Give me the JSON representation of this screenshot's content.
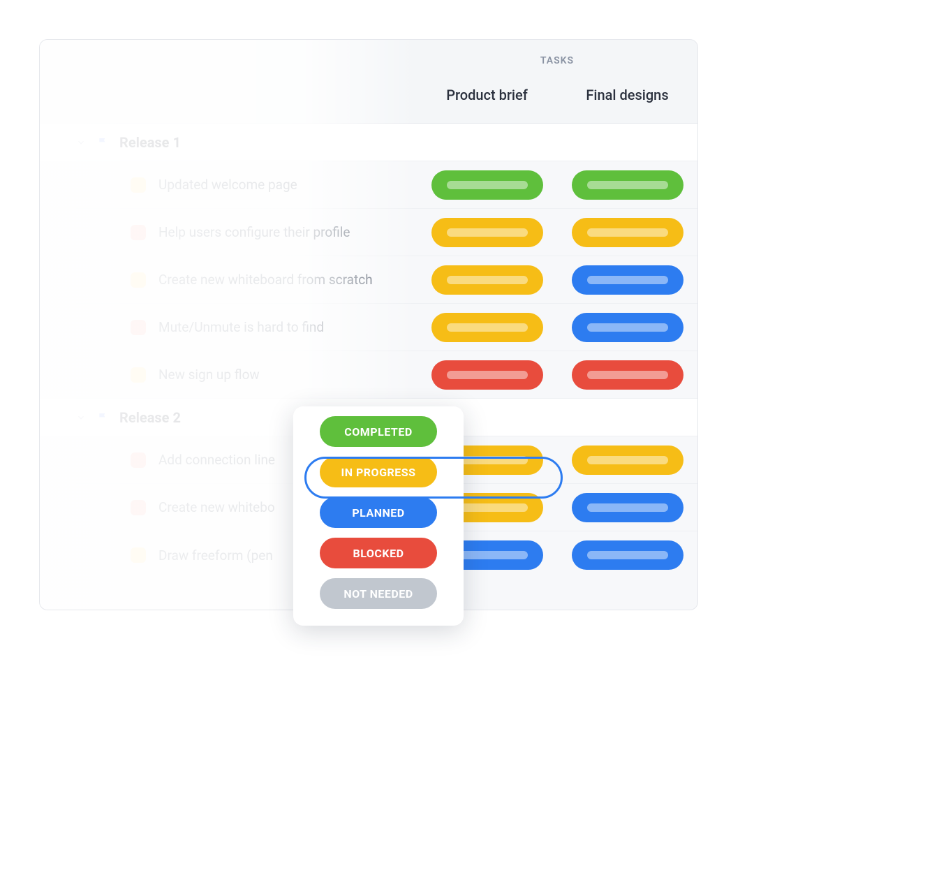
{
  "header": {
    "tasks_label": "TASKS",
    "columns": [
      "Product brief",
      "Final designs"
    ]
  },
  "colors": {
    "completed": "#5fbf3c",
    "in_progress": "#f6bd16",
    "planned": "#2d7cf0",
    "blocked": "#e84c3d",
    "not_needed": "#c1c7cf"
  },
  "groups": [
    {
      "title": "Release 1",
      "flag_color": "#7ea2ff",
      "rows": [
        {
          "chip": "yellow",
          "text": "Updated welcome page",
          "statuses": [
            "completed",
            "completed"
          ]
        },
        {
          "chip": "red",
          "text": "Help users configure their profile",
          "statuses": [
            "in_progress",
            "in_progress"
          ]
        },
        {
          "chip": "yellow",
          "text": "Create new whiteboard from scratch",
          "statuses": [
            "in_progress",
            "planned"
          ]
        },
        {
          "chip": "red",
          "text": "Mute/Unmute is hard to find",
          "statuses": [
            "in_progress",
            "planned"
          ]
        },
        {
          "chip": "yellow",
          "text": "New sign up flow",
          "statuses": [
            "blocked",
            "blocked"
          ]
        }
      ]
    },
    {
      "title": "Release 2",
      "flag_color": "#7ea2ff",
      "rows": [
        {
          "chip": "red",
          "text": "Add connection line",
          "statuses": [
            "in_progress",
            "in_progress"
          ]
        },
        {
          "chip": "red",
          "text": "Create new whitebo",
          "statuses": [
            "in_progress",
            "planned"
          ]
        },
        {
          "chip": "yellow",
          "text": "Draw freeform (pen",
          "statuses": [
            "planned",
            "planned"
          ]
        }
      ]
    }
  ],
  "popover": {
    "options": [
      {
        "key": "completed",
        "label": "COMPLETED"
      },
      {
        "key": "in_progress",
        "label": "IN PROGRESS"
      },
      {
        "key": "planned",
        "label": "PLANNED"
      },
      {
        "key": "blocked",
        "label": "BLOCKED"
      },
      {
        "key": "not_needed",
        "label": "NOT NEEDED"
      }
    ],
    "selected_key": "in_progress"
  }
}
